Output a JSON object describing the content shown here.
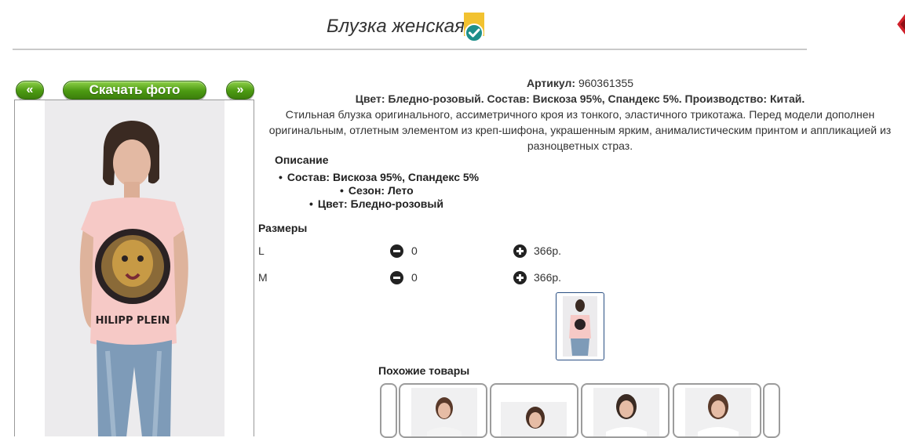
{
  "header": {
    "title": "Блузка женская"
  },
  "gallery": {
    "prev_label": "«",
    "download_label": "Скачать фото",
    "next_label": "»",
    "photo_print_text": "HILIPP PLEIN"
  },
  "product": {
    "article_label": "Артикул:",
    "article_value": "960361355",
    "summary": "Цвет: Бледно-розовый. Состав: Вискоза 95%, Спандекс 5%. Производство: Китай.",
    "description_line1": "Стильная блузка оригинального, ассиметричного кроя из тонкого, эластичного трикотажа. Перед модели дополнен",
    "description_line2": "оригинальным, отлетным элементом из креп-шифона, украшенным ярким, анималистическим принтом и аппликацией из",
    "description_line3": "разноцветных страз.",
    "specs_heading": "Описание",
    "specs": [
      "Состав: Вискоза 95%, Спандекс 5%",
      "Сезон: Лето",
      "Цвет: Бледно-розовый"
    ]
  },
  "sizes": {
    "heading": "Размеры",
    "rows": [
      {
        "name": "L",
        "qty": "0",
        "price": "366р."
      },
      {
        "name": "M",
        "qty": "0",
        "price": "366р."
      }
    ]
  },
  "similar": {
    "heading": "Похожие товары"
  },
  "colors": {
    "accent_green": "#4c9a12",
    "badge_teal": "#1e8f8a",
    "badge_yellow": "#f2c230",
    "close_red": "#d0202a",
    "shirt_pink": "#f6c9c6"
  },
  "icons": {
    "verified": "verified-check-icon",
    "close": "close-icon",
    "minus": "minus-circle-icon",
    "plus": "plus-circle-icon"
  }
}
